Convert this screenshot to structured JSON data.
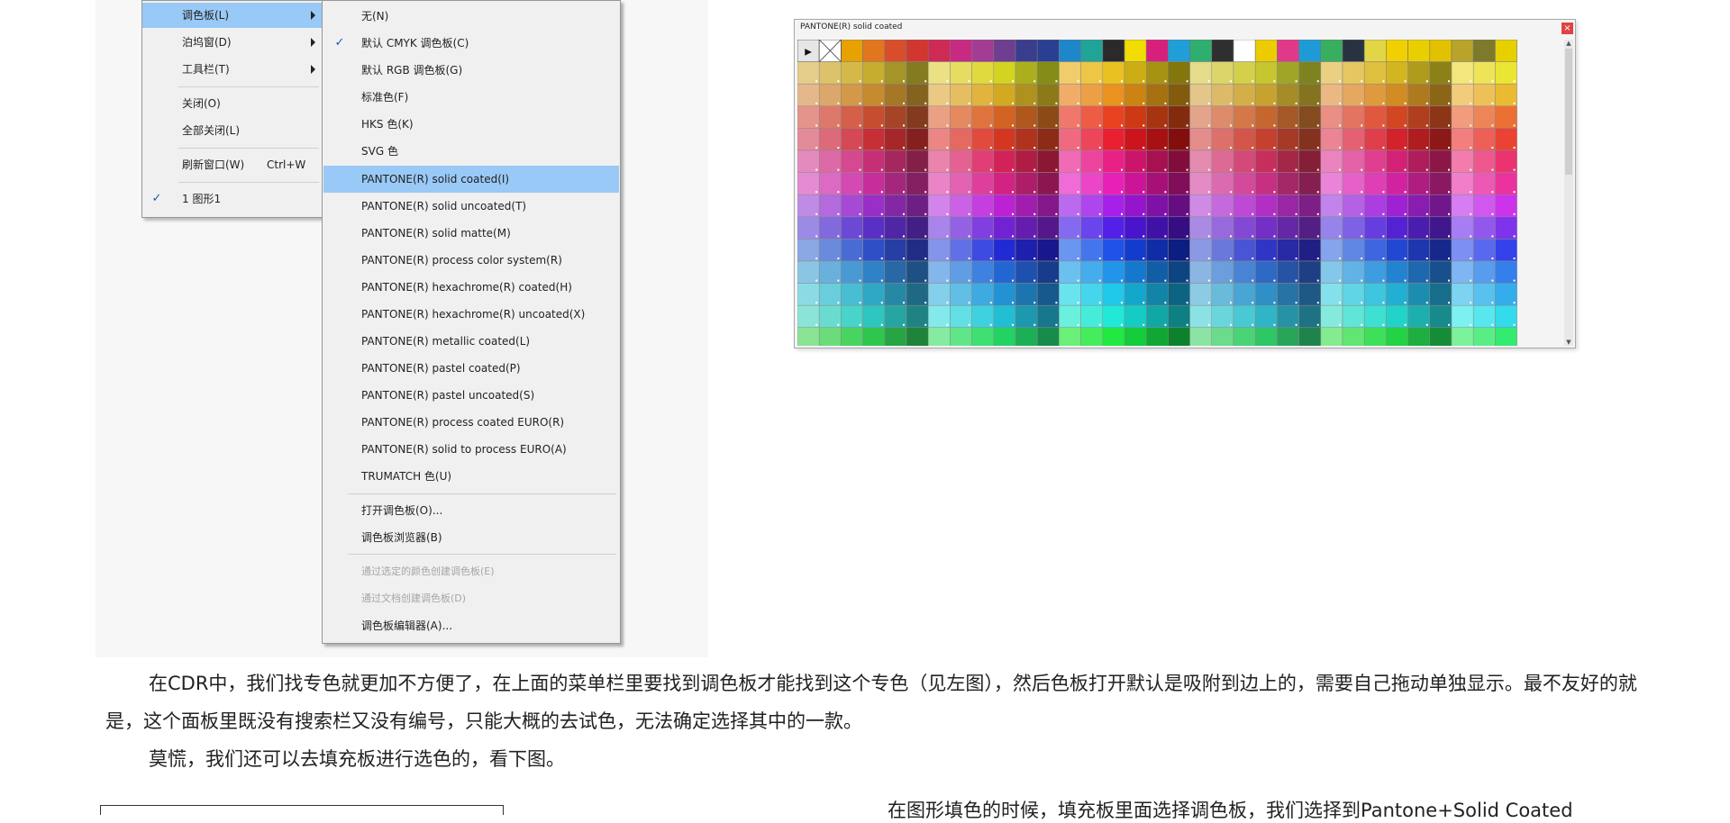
{
  "menu": {
    "items": [
      {
        "label": "调色板(L)",
        "submenu": true,
        "highlighted": true
      },
      {
        "label": "泊坞窗(D)",
        "submenu": true
      },
      {
        "label": "工具栏(T)",
        "submenu": true
      },
      {
        "label": "关闭(O)"
      },
      {
        "label": "全部关闭(L)"
      },
      {
        "label": "刷新窗口(W)",
        "shortcut": "Ctrl+W"
      },
      {
        "label": "1 图形1",
        "checked": true
      }
    ]
  },
  "submenu": {
    "items": [
      {
        "label": "无(N)"
      },
      {
        "label": "默认 CMYK 调色板(C)",
        "checked": true
      },
      {
        "label": "默认 RGB 调色板(G)"
      },
      {
        "label": "标准色(F)"
      },
      {
        "label": "HKS 色(K)"
      },
      {
        "label": "SVG 色"
      },
      {
        "label": "PANTONE(R) solid coated(I)",
        "highlighted": true
      },
      {
        "label": "PANTONE(R) solid uncoated(T)"
      },
      {
        "label": "PANTONE(R) solid matte(M)"
      },
      {
        "label": "PANTONE(R) process color system(R)"
      },
      {
        "label": "PANTONE(R) hexachrome(R) coated(H)"
      },
      {
        "label": "PANTONE(R) hexachrome(R) uncoated(X)"
      },
      {
        "label": "PANTONE(R) metallic coated(L)"
      },
      {
        "label": "PANTONE(R) pastel coated(P)"
      },
      {
        "label": "PANTONE(R) pastel uncoated(S)"
      },
      {
        "label": "PANTONE(R) process coated EURO(R)"
      },
      {
        "label": "PANTONE(R) solid to process EURO(A)"
      },
      {
        "label": "TRUMATCH 色(U)"
      },
      {
        "label": "打开调色板(O)..."
      },
      {
        "label": "调色板浏览器(B)"
      },
      {
        "label": "通过选定的颜色创建调色板(E)",
        "disabled": true
      },
      {
        "label": "通过文档创建调色板(D)",
        "disabled": true
      },
      {
        "label": "调色板编辑器(A)..."
      }
    ]
  },
  "palette_window": {
    "title": "PANTONE(R) solid coated",
    "close_glyph": "×",
    "play_glyph": "▶",
    "scroll_up_glyph": "▲",
    "scroll_down_glyph": "▼",
    "top_row": [
      "#e8d500",
      "#f3d200",
      "#e7a100",
      "#e1761f",
      "#d84e2a",
      "#d1372f",
      "#cf2a56",
      "#c62a83",
      "#a33d94",
      "#6e3e91",
      "#3a3d8e",
      "#2a3f91",
      "#1d87c9",
      "#20a497",
      "#2a2a2a",
      "#f1dd00",
      "#d7207b",
      "#1f9ed8",
      "#2eae6f",
      "#2f2f2f",
      "#ffffff",
      "#eccc00",
      "#e0398a",
      "#1e9bd6",
      "#38ae5f",
      "#293241",
      "#e3d646",
      "#f0d000",
      "#e9cf00",
      "#e2c200",
      "#b9a32a",
      "#7d7a2b",
      "#e7d000"
    ],
    "col_hues": [
      52,
      45,
      40,
      35,
      30,
      24,
      50,
      42,
      38,
      28,
      22,
      18,
      44,
      36,
      32,
      26,
      20,
      16,
      48,
      40,
      34,
      30,
      24,
      18,
      55,
      46,
      38,
      30,
      24,
      16,
      12,
      8,
      50
    ],
    "hue_bands": [
      48,
      34,
      10,
      355,
      330,
      315,
      280,
      255,
      225,
      205,
      190,
      175,
      130
    ]
  },
  "article": {
    "p1": "在CDR中，我们找专色就更加不方便了，在上面的菜单栏里要找到调色板才能找到这个专色（见左图），然后色板打开默认是吸附到边上的，需要自己拖动单独显示。最不友好的就是，这个面板里既没有搜索栏又没有编号，只能大概的去试色，无法确定选择其中的一款。",
    "p2": "莫慌，我们还可以去填充板进行选色的，看下图。",
    "p3": "在图形填色的时候，填充板里面选择调色板，我们选择到Pantone+Solid  Coated"
  }
}
